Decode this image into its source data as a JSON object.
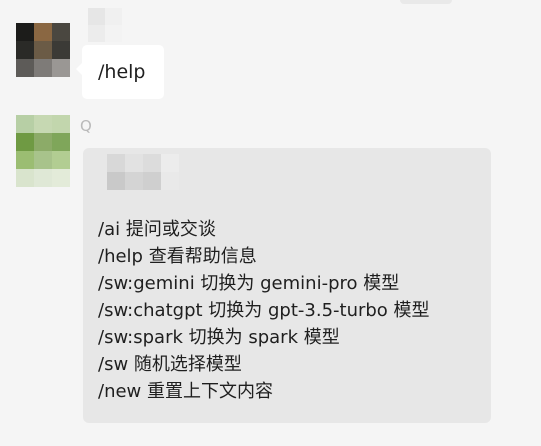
{
  "messages": [
    {
      "avatar_colors": [
        "#1c1c1a",
        "#8a6742",
        "#4a4740",
        "#2a2a27",
        "#6b5b46",
        "#3b3a36",
        "#5d5b58",
        "#7e7b78",
        "#9a9794"
      ],
      "name_blur_colors": [
        "#e6e6e6",
        "#f0f0f0",
        "#ececec",
        "#f3f3f3"
      ],
      "text": "/help"
    },
    {
      "avatar_colors": [
        "#b7cfa5",
        "#c6d8b2",
        "#c2d6ad",
        "#6f9a43",
        "#8cab68",
        "#7fa65a",
        "#9bbd72",
        "#a8c38b",
        "#b2cd92",
        "#d9e4cd",
        "#dfe8d6",
        "#e3ebd9"
      ],
      "sender_mark": "Q",
      "header_blur_colors": [
        "#d8d8d8",
        "#e2e2e2",
        "#dcdcdc",
        "#ececec",
        "#c9c9c9",
        "#d4d4d4",
        "#cfcfcf",
        "#e9e9e9"
      ],
      "lines": [
        "/ai 提问或交谈",
        "/help 查看帮助信息",
        "/sw:gemini 切换为 gemini-pro 模型",
        "/sw:chatgpt 切换为 gpt-3.5-turbo 模型",
        "/sw:spark 切换为 spark 模型",
        "/sw 随机选择模型",
        "/new 重置上下文内容"
      ]
    }
  ]
}
